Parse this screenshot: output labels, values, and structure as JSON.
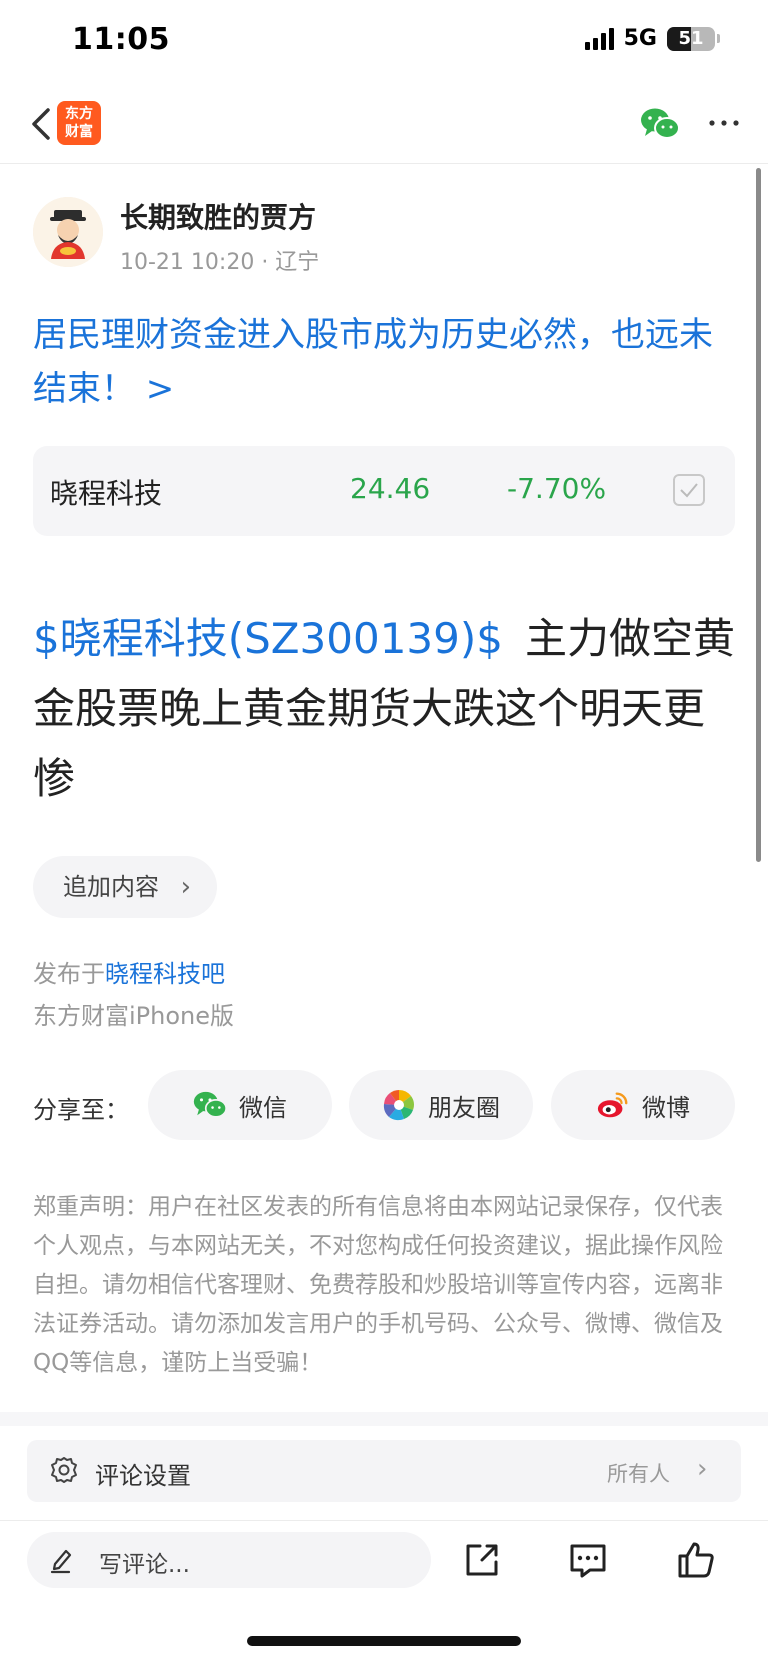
{
  "status_bar": {
    "time": "11:05",
    "network": "5G",
    "battery": "51"
  },
  "nav": {
    "logo_text": "东方\n财富",
    "back_icon": "chevron-left-icon",
    "share_icon": "wechat-icon",
    "more_icon": "more-horizontal-icon"
  },
  "author": {
    "name": "长期致胜的贾方",
    "meta": "10-21 10:20 · 辽宁"
  },
  "headline": "居民理财资金进入股市成为历史必然，也远未结束！ >",
  "stock": {
    "name": "晓程科技",
    "price": "24.46",
    "change": "-7.70%"
  },
  "post": {
    "tag": "$晓程科技(SZ300139)$",
    "text": "主力做空黄金股票晚上黄金期货大跌这个明天更惨"
  },
  "add_content": {
    "label": "追加内容",
    "chevron": "›"
  },
  "published": {
    "prefix": "发布于",
    "board": "晓程科技吧",
    "client": "东方财富iPhone版"
  },
  "share": {
    "label": "分享至：",
    "buttons": [
      {
        "label": "微信",
        "icon": "wechat-icon"
      },
      {
        "label": "朋友圈",
        "icon": "moments-icon"
      },
      {
        "label": "微博",
        "icon": "weibo-icon"
      }
    ]
  },
  "disclaimer": "郑重声明：用户在社区发表的所有信息将由本网站记录保存，仅代表个人观点，与本网站无关，不对您构成任何投资建议，据此操作风险自担。请勿相信代客理财、免费荐股和炒股培训等宣传内容，远离非法证券活动。请勿添加发言用户的手机号码、公众号、微博、微信及QQ等信息，谨防上当受骗！",
  "comment_settings": {
    "label": "评论设置",
    "value": "所有人",
    "chevron": "›"
  },
  "bottom_bar": {
    "write_placeholder": "写评论...",
    "icons": [
      "share-out-icon",
      "comment-icon",
      "like-icon"
    ]
  },
  "colors": {
    "link": "#1a73d9",
    "down": "#2aa54b",
    "logo": "#ff5a1f"
  }
}
